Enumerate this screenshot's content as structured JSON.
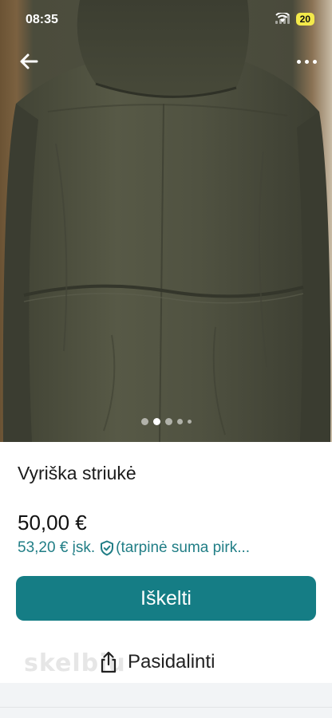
{
  "status_bar": {
    "time": "08:35",
    "battery": "20"
  },
  "nav": {
    "back_icon": "arrow-left-icon",
    "more_icon": "more-dots-icon"
  },
  "gallery": {
    "image": "olive green men's jacket photographed from the back",
    "page_count": 5,
    "active_index": 1
  },
  "listing": {
    "title": "Vyriška striukė",
    "price": "50,00 €",
    "price_incl": "53,20 € įsk.",
    "price_incl_note": "(tarpinė suma pirk...",
    "buy_button": "Iškelti",
    "share_button": "Pasidalinti",
    "watermark": "skelbiu"
  },
  "colors": {
    "accent": "#157d85",
    "accent_text": "#217e86",
    "battery": "#f3e94a",
    "jacket": "#4e4f40"
  }
}
